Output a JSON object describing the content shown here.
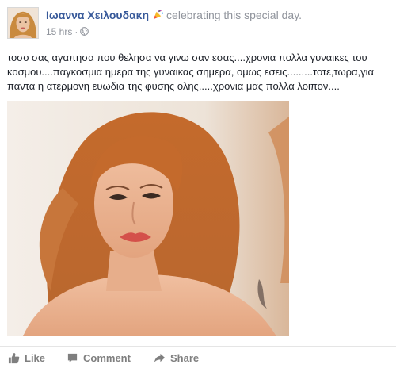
{
  "post": {
    "author": "Ιωαννα Χειλουδακη",
    "activity": "celebrating this special day.",
    "time": "15 hrs",
    "separator": "·",
    "audience_icon": "globe-icon",
    "activity_icon": "party-popper-icon",
    "text": "τοσο σας αγαπησα που θελησα να γινω σαν εσας....χρονια πολλα γυναικες του κοσμου....παγκοσμια ημερα της γυναικας σημερα, ομως εσεις.........τοτε,τωρα,για παντα η ατερμονη ευωδια της φυσης ολης.....χρονια μας πολλα λοιπον....",
    "photo_icon": "portrait-photo"
  },
  "actions": {
    "like": "Like",
    "comment": "Comment",
    "share": "Share"
  },
  "colors": {
    "author": "#365899",
    "muted": "#90949c",
    "action": "#7f7f7f"
  }
}
